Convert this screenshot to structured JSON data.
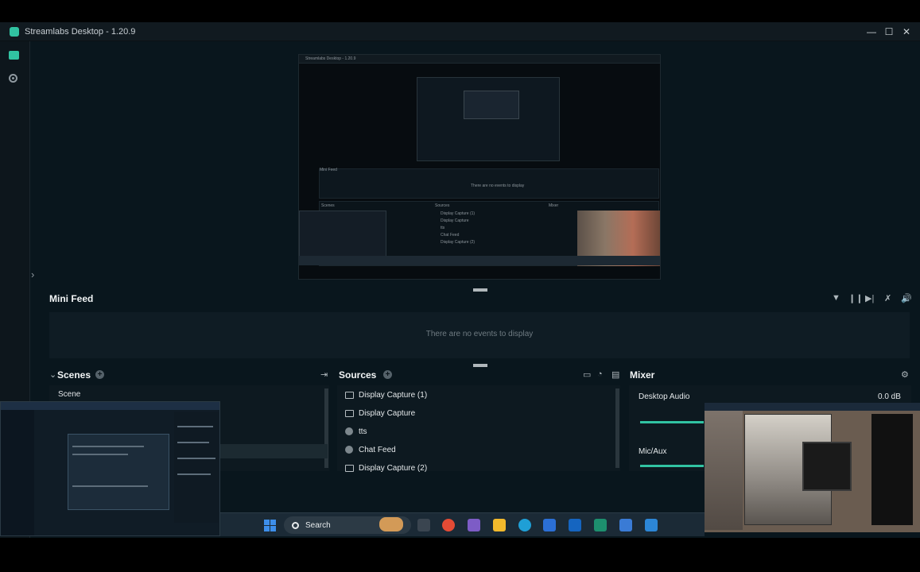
{
  "window": {
    "title": "Streamlabs Desktop - 1.20.9",
    "minimize": "—",
    "maximize": "☐",
    "close": "✕"
  },
  "nav": {
    "studio_icon": "studio-mode-icon",
    "record_icon": "record-icon",
    "expand": "›"
  },
  "preview": {
    "nested_title": "Streamlabs Desktop - 1.20.9",
    "nested_minifeed": "Mini Feed",
    "nested_empty": "There are no events to display",
    "nested_scenes": "Scenes",
    "nested_sources": "Sources",
    "nested_mixer": "Mixer",
    "nested_sources_list": [
      "Display Capture (1)",
      "Display Capture",
      "tts",
      "Chat Feed",
      "Display Capture (2)"
    ]
  },
  "minifeed": {
    "title": "Mini Feed",
    "empty": "There are no events to display",
    "controls": {
      "filter": "▼",
      "pause": "❙❙",
      "skip": "▶|",
      "mute_alerts": "✗",
      "volume": "🔊"
    }
  },
  "scenes": {
    "title": "Scenes",
    "collapse": "⌄",
    "add": "+",
    "transitions_icon": "⇥",
    "items": [
      "Scene"
    ]
  },
  "sources": {
    "title": "Sources",
    "add": "+",
    "items": [
      {
        "label": "Display Capture (1)",
        "icon": "monitor"
      },
      {
        "label": "Display Capture",
        "icon": "monitor"
      },
      {
        "label": "tts",
        "icon": "globe"
      },
      {
        "label": "Chat Feed",
        "icon": "globe"
      },
      {
        "label": "Display Capture (2)",
        "icon": "monitor"
      }
    ]
  },
  "mixer": {
    "title": "Mixer",
    "settings": "⚙",
    "channels": [
      {
        "name": "Desktop Audio",
        "db": "0.0 dB"
      },
      {
        "name": "Mic/Aux",
        "db": ""
      }
    ]
  },
  "taskbar": {
    "search_label": "Search"
  },
  "colors": {
    "accent": "#31c3a2",
    "background": "#09161d",
    "panel": "#0d1920",
    "titlebar": "#111a20"
  }
}
